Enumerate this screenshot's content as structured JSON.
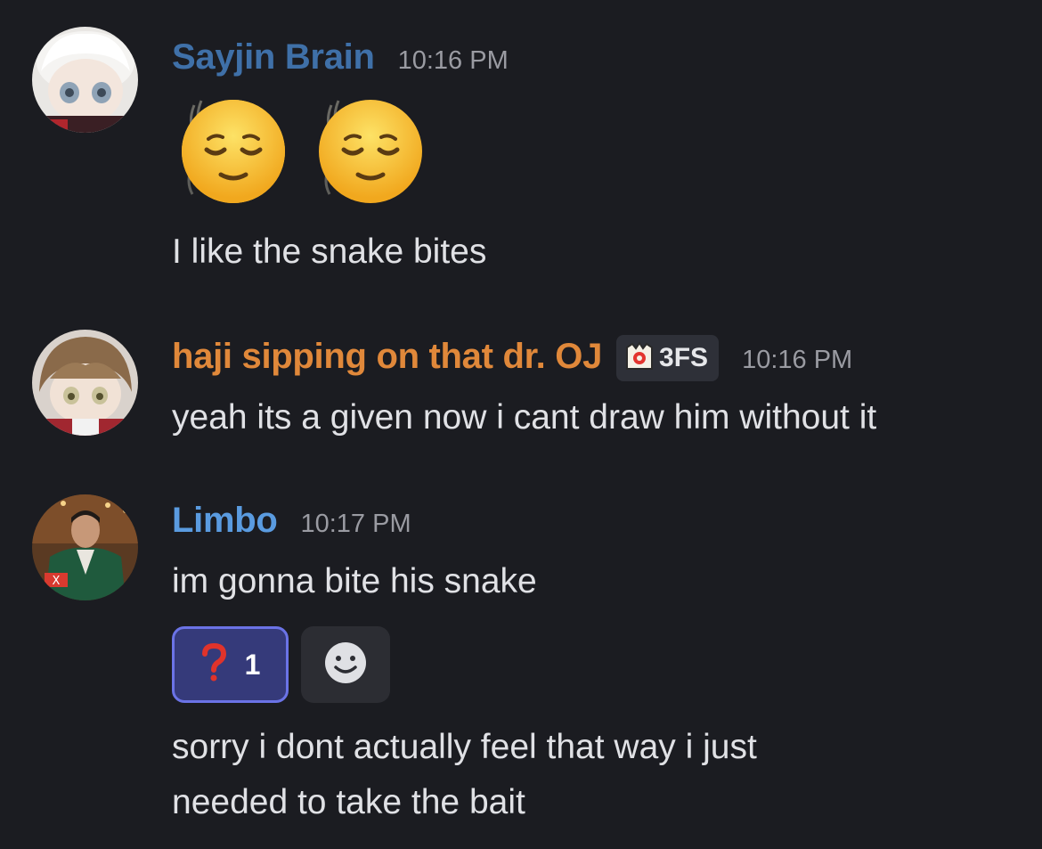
{
  "messages": [
    {
      "username": "Sayjin Brain",
      "username_color": "#3f70a8",
      "timestamp": "10:16 PM",
      "emojis": [
        "sweat-smile-sleeping-face-emoji",
        "sweat-smile-sleeping-face-emoji"
      ],
      "text": "I like the snake bites"
    },
    {
      "username": "haji sipping on that dr. OJ",
      "username_color": "#e0883a",
      "tag": {
        "icon": "guild-badge-icon",
        "label": "3FS"
      },
      "timestamp": "10:16 PM",
      "text": "yeah its a given now i cant draw him without it"
    },
    {
      "username": "Limbo",
      "username_color": "#5a9be0",
      "timestamp": "10:17 PM",
      "text": "im gonna bite his snake",
      "reactions": [
        {
          "emoji": "question-mark-icon",
          "count": "1",
          "active": true
        }
      ],
      "add_reaction_icon": "smiley-add-reaction-icon",
      "followup_lines": [
        "sorry i dont actually feel that way i just",
        "needed to take the bait"
      ]
    }
  ]
}
